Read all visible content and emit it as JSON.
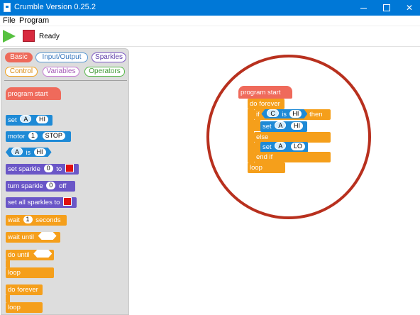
{
  "window": {
    "title": "Crumble Version 0.25.2"
  },
  "menu": {
    "file": "File",
    "program": "Program"
  },
  "toolbar": {
    "status": "Ready"
  },
  "palette": {
    "categories": {
      "basic": "Basic",
      "io": "Input/Output",
      "sparkles": "Sparkles",
      "control": "Control",
      "variables": "Variables",
      "operators": "Operators"
    },
    "blocks": {
      "program_start": "program start",
      "set": "set",
      "set_var": "A",
      "set_value": "HI",
      "motor": "motor",
      "motor_num": "1",
      "motor_state": "STOP",
      "is_var": "A",
      "is": "is",
      "is_value": "HI",
      "set_sparkle": "set sparkle",
      "set_sparkle_num": "0",
      "to": "to",
      "turn_sparkle": "turn sparkle",
      "turn_sparkle_num": "0",
      "off": "off",
      "set_all_sparkles": "set all sparkles to",
      "wait": "wait",
      "wait_num": "1",
      "seconds": "seconds",
      "wait_until": "wait until",
      "do_until": "do until",
      "loop": "loop",
      "do_forever": "do forever",
      "loop2": "loop"
    }
  },
  "program": {
    "program_start": "program start",
    "do_forever": "do forever",
    "if": "if",
    "if_var": "C",
    "is": "is",
    "if_value": "HI",
    "then": "then",
    "set1": "set",
    "set1_var": "A",
    "set1_value": "HI",
    "else": "else",
    "set2": "set",
    "set2_var": "A",
    "set2_value": "LO",
    "end_if": "end if",
    "loop": "loop"
  },
  "colors": {
    "titlebar": "#0078d7",
    "basic_red": "#ef6a5b",
    "io_blue": "#1e8ad6",
    "sparkle_purple": "#6a56c7",
    "control_orange": "#f59f1b",
    "highlight_ring": "#b8301e",
    "play_green": "#57c140",
    "stop_red": "#d82a3e"
  },
  "icons": {
    "app": "app-icon",
    "play": "play-icon",
    "stop": "stop-icon",
    "minimize": "minimize-icon",
    "maximize": "maximize-icon",
    "close": "close-icon"
  }
}
